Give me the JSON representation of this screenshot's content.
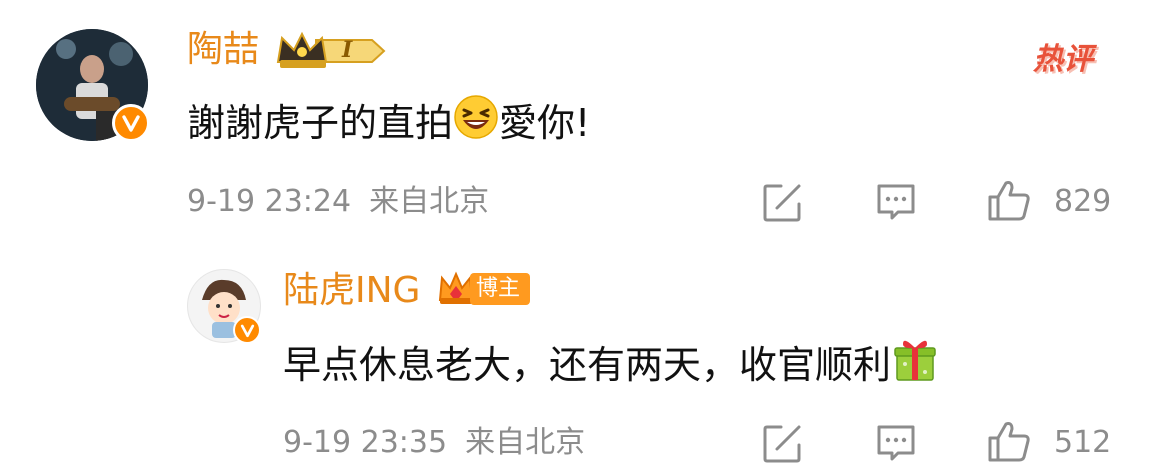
{
  "comments": [
    {
      "username": "陶喆",
      "level_badge": "I",
      "hot_tag": "热评",
      "content_before_emoji": "謝謝虎子的直拍",
      "emoji_icon": "laughing-face-icon",
      "content_after_emoji": "愛你!",
      "time": "9-19 23:24",
      "location": "来自北京",
      "like_count": "829"
    },
    {
      "username": "陆虎ING",
      "role_badge": "博主",
      "content_before_emoji": "早点休息老大，还有两天，收官顺利",
      "emoji_icon": "gift-icon",
      "time": "9-19 23:35",
      "location": "来自北京",
      "like_count": "512"
    }
  ],
  "icons": {
    "share": "share-icon",
    "comment": "comment-icon",
    "like": "thumbs-up-icon",
    "verified": "verified-badge-icon",
    "crown": "crown-icon"
  },
  "colors": {
    "username": "#e8891a",
    "meta_text": "#8c8c8c",
    "hot_tag": "#e8523a",
    "verified_badge": "#ff8a00",
    "blogger_badge": "#ff9a1f"
  }
}
